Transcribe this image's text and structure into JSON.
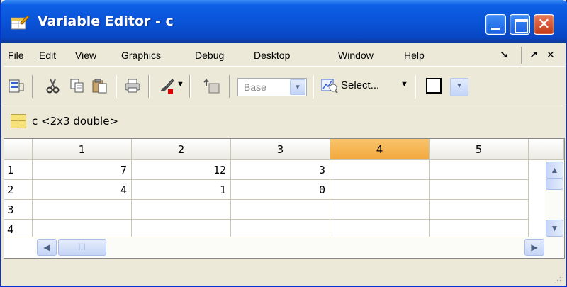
{
  "window": {
    "title": "Variable Editor - c",
    "close_glyph": "✕"
  },
  "menu": {
    "items": [
      {
        "label": "File",
        "underline": "F",
        "rest": "ile"
      },
      {
        "label": "Edit",
        "underline": "E",
        "rest": "dit"
      },
      {
        "label": "View",
        "underline": "V",
        "rest": "iew"
      },
      {
        "label": "Graphics",
        "underline": "G",
        "rest": "raphics"
      },
      {
        "label": "Debug",
        "pre": "De",
        "underline": "b",
        "rest": "ug"
      },
      {
        "label": "Desktop",
        "underline": "D",
        "rest": "esktop"
      },
      {
        "label": "Window",
        "underline": "W",
        "rest": "indow"
      },
      {
        "label": "Help",
        "underline": "H",
        "rest": "elp"
      }
    ],
    "dock_glyph": "↘",
    "undock_glyph": "↗",
    "close_glyph": "✕"
  },
  "toolbar": {
    "base_combo": "Base",
    "select_label": "Select...",
    "combo_arrow": "▾",
    "dropdown_arrow": "▼"
  },
  "variable": {
    "label": "c <2x3 double>"
  },
  "grid": {
    "column_headers": [
      "1",
      "2",
      "3",
      "4",
      "5"
    ],
    "active_column": "4",
    "row_headers": [
      "1",
      "2",
      "3",
      "4"
    ],
    "rows": [
      [
        "7",
        "12",
        "3",
        "",
        ""
      ],
      [
        "4",
        "1",
        "0",
        "",
        ""
      ],
      [
        "",
        "",
        "",
        "",
        ""
      ],
      [
        "",
        "",
        "",
        "",
        ""
      ]
    ]
  },
  "scrollbars": {
    "up_glyph": "▲",
    "down_glyph": "▼",
    "left_glyph": "◀",
    "right_glyph": "▶",
    "thumb_grip": "|||"
  },
  "colors": {
    "titlebar": "#0a54d8",
    "active_header": "#f3a83c",
    "chrome": "#ece9d8"
  }
}
